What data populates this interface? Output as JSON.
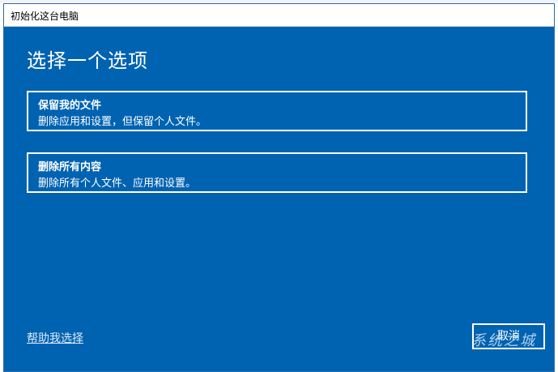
{
  "window": {
    "title": "初始化这台电脑"
  },
  "dialog": {
    "heading": "选择一个选项",
    "options": [
      {
        "title": "保留我的文件",
        "description": "删除应用和设置，但保留个人文件。"
      },
      {
        "title": "删除所有内容",
        "description": "删除所有个人文件、应用和设置。"
      }
    ],
    "help_link": "帮助我选择",
    "cancel_label": "取消"
  },
  "watermark": "系统之城",
  "colors": {
    "dialog_background": "#0063b1",
    "text": "#ffffff"
  }
}
